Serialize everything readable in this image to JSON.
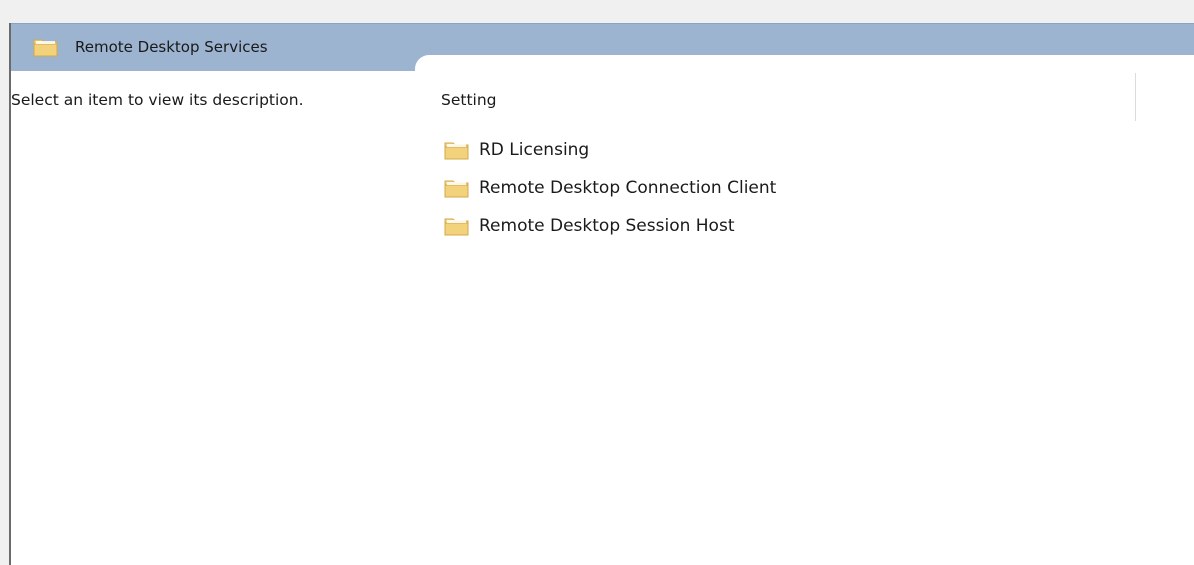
{
  "header": {
    "title": "Remote Desktop Services",
    "icon": "folder-icon"
  },
  "description_pane": {
    "text": "Select an item to view its description."
  },
  "list": {
    "column_header": "Setting",
    "items": [
      {
        "label": "RD Licensing",
        "icon": "folder-icon"
      },
      {
        "label": "Remote Desktop Connection Client",
        "icon": "folder-icon"
      },
      {
        "label": "Remote Desktop Session Host",
        "icon": "folder-icon"
      }
    ]
  },
  "colors": {
    "header_bg": "#9db4d1",
    "folder_fill": "#f2d27a",
    "folder_edge": "#d2a84a"
  }
}
